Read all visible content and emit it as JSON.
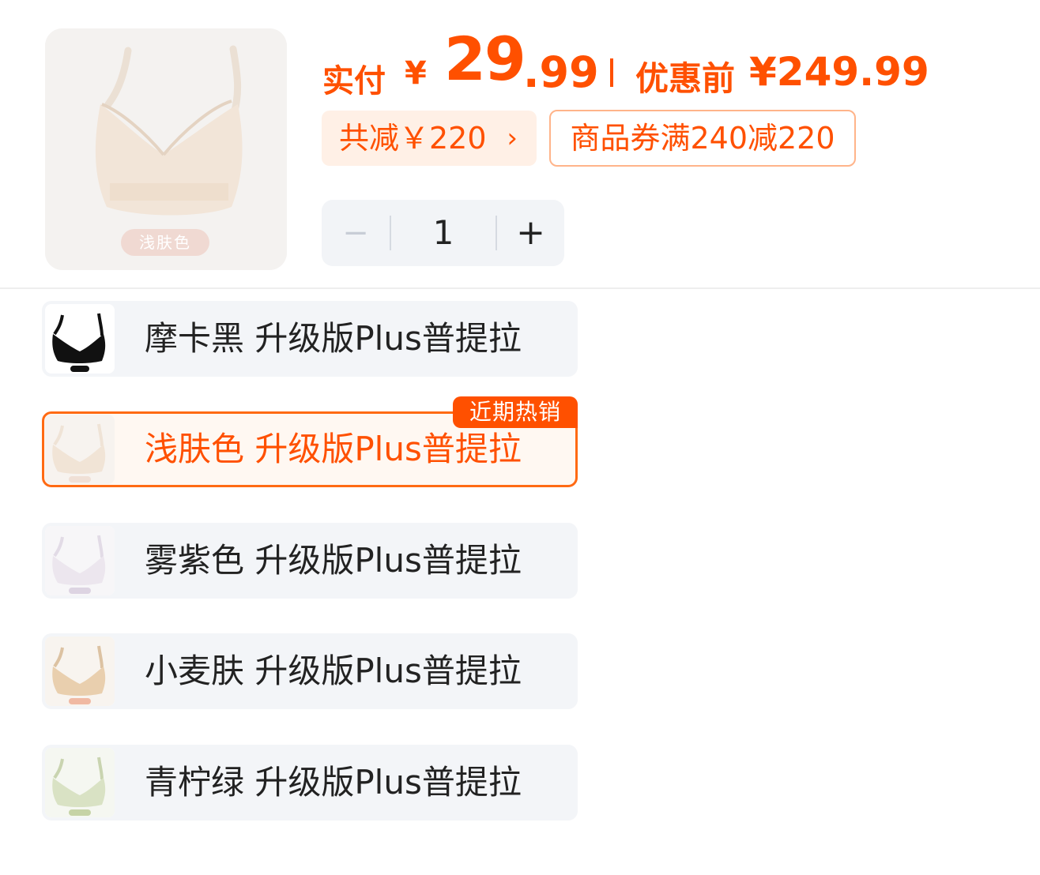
{
  "product": {
    "selected_color_tag": "浅肤色"
  },
  "price": {
    "pay_label": "实付",
    "currency": "¥",
    "pay_integer": "29",
    "pay_decimal": ".99",
    "original_label": "优惠前",
    "original_price": "¥249.99"
  },
  "discount": {
    "total_label": "共减￥220",
    "chevron": "›",
    "coupon_label": "商品券满240减220"
  },
  "quantity": {
    "minus_symbol": "−",
    "value": "1",
    "plus_symbol": "+"
  },
  "hot_badge": "近期热销",
  "variants": [
    {
      "label": "摩卡黑 升级版Plus普提拉",
      "color": "#111111",
      "selected": false
    },
    {
      "label": "浅肤色 升级版Plus普提拉",
      "color": "#f1e4d6",
      "selected": true
    },
    {
      "label": "雾紫色 升级版Plus普提拉",
      "color": "#ece6ee",
      "selected": false
    },
    {
      "label": "小麦肤 升级版Plus普提拉",
      "color": "#e9cfae",
      "selected": false
    },
    {
      "label": "青柠绿 升级版Plus普提拉",
      "color": "#d9e2c4",
      "selected": false
    }
  ],
  "colors": {
    "accent": "#ff5000",
    "selected_border": "#ff6a13",
    "chip_bg": "#fff0e6",
    "row_bg": "#f3f5f8"
  }
}
